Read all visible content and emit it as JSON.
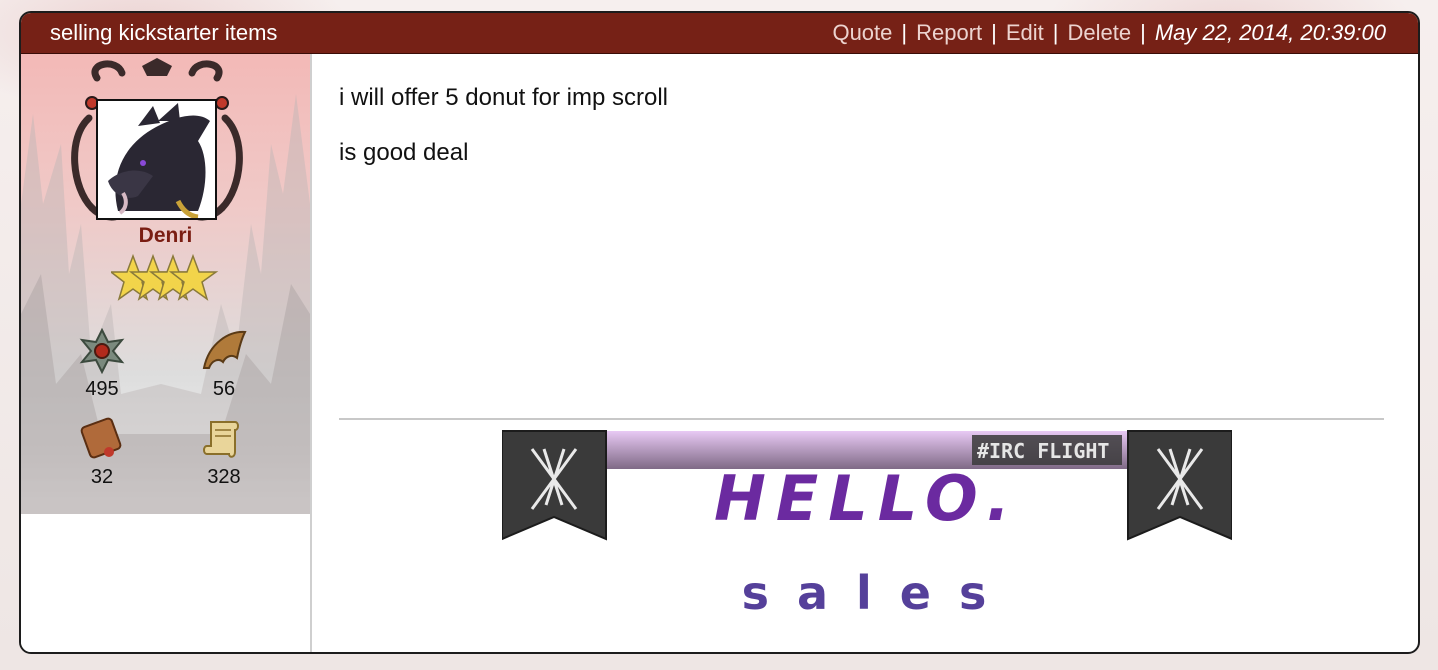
{
  "post": {
    "title": "selling kickstarter items",
    "actions": [
      "Quote",
      "Report",
      "Edit",
      "Delete"
    ],
    "date": "May 22, 2014, 20:39:00"
  },
  "user": {
    "name": "Denri",
    "stats": [
      {
        "icon": "badge-icon",
        "value": "495"
      },
      {
        "icon": "wing-icon",
        "value": "56"
      },
      {
        "icon": "book-icon",
        "value": "32"
      },
      {
        "icon": "scroll-icon",
        "value": "328"
      }
    ]
  },
  "message": {
    "lines": [
      "i will offer 5 donut for imp scroll",
      "is good deal"
    ]
  },
  "signature": {
    "tag": "#IRC FLIGHT",
    "headline": "HELLO.",
    "subline": "s a l e s"
  },
  "colors": {
    "header_bg": "#762116",
    "username": "#7a1d12",
    "signature_purple": "#6b2aa0"
  }
}
